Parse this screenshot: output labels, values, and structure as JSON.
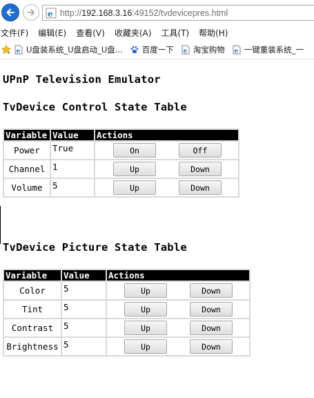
{
  "browser": {
    "url_scheme": "http://",
    "url_host": "192.168.3.16",
    "url_rest": ":49152/tvdevicepres.html",
    "menu": [
      "文件(F)",
      "编辑(E)",
      "查看(V)",
      "收藏夹(A)",
      "工具(T)",
      "帮助(H)"
    ],
    "favorites": [
      {
        "label": "U盘装系统_U盘启动_U盘...",
        "icon": "document-icon"
      },
      {
        "label": "百度一下",
        "icon": "baidu-paw-icon"
      },
      {
        "label": "淘宝购物",
        "icon": "document-icon"
      },
      {
        "label": "一键重装系统_一",
        "icon": "document-icon"
      }
    ]
  },
  "page": {
    "title": "UPnP Television Emulator",
    "control_heading": "TvDevice Control State Table",
    "picture_heading": "TvDevice Picture State Table",
    "headers": {
      "variable": "Variable",
      "value": "Value",
      "actions": "Actions"
    }
  },
  "control_table": [
    {
      "variable": "Power",
      "value": "True",
      "btn1": "On",
      "btn2": "Off"
    },
    {
      "variable": "Channel",
      "value": "1",
      "btn1": "Up",
      "btn2": "Down"
    },
    {
      "variable": "Volume",
      "value": "5",
      "btn1": "Up",
      "btn2": "Down"
    }
  ],
  "picture_table": [
    {
      "variable": "Color",
      "value": "5",
      "btn1": "Up",
      "btn2": "Down"
    },
    {
      "variable": "Tint",
      "value": "5",
      "btn1": "Up",
      "btn2": "Down"
    },
    {
      "variable": "Contrast",
      "value": "5",
      "btn1": "Up",
      "btn2": "Down"
    },
    {
      "variable": "Brightness",
      "value": "5",
      "btn1": "Up",
      "btn2": "Down"
    }
  ]
}
